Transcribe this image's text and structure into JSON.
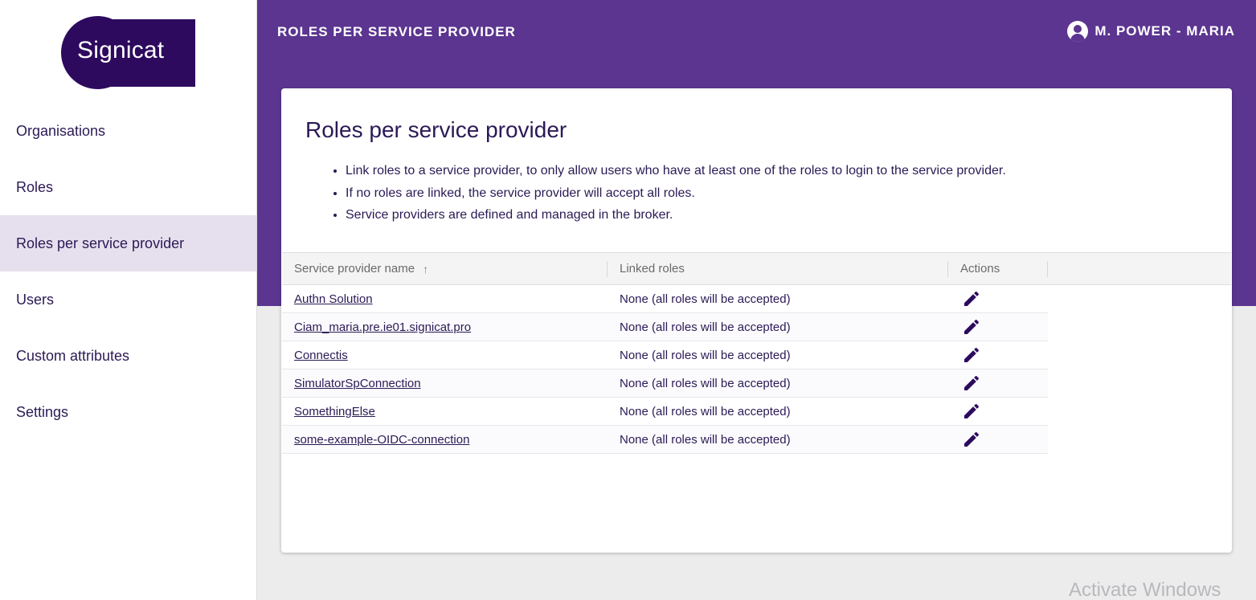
{
  "brand": {
    "name": "Signicat",
    "color": "#2d0a5e"
  },
  "sidebar": {
    "items": [
      {
        "label": "Organisations",
        "active": false
      },
      {
        "label": "Roles",
        "active": false
      },
      {
        "label": "Roles per service provider",
        "active": true
      },
      {
        "label": "Users",
        "active": false
      },
      {
        "label": "Custom attributes",
        "active": false
      },
      {
        "label": "Settings",
        "active": false
      }
    ]
  },
  "header": {
    "title": "ROLES PER SERVICE PROVIDER",
    "user": "M. POWER - MARIA",
    "user_icon": "account-circle-icon",
    "background": "#5b3590"
  },
  "main": {
    "title": "Roles per service provider",
    "bullets": [
      "Link roles to a service provider, to only allow users who have at least one of the roles to login to the service provider.",
      "If no roles are linked, the service provider will accept all roles.",
      "Service providers are defined and managed in the broker."
    ],
    "table": {
      "columns": [
        "Service provider name",
        "Linked roles",
        "Actions"
      ],
      "sort_icon": "arrow-up-icon",
      "sort_symbol": "↑",
      "rows": [
        {
          "name": "Authn Solution",
          "roles": "None (all roles will be accepted)"
        },
        {
          "name": "Ciam_maria.pre.ie01.signicat.pro",
          "roles": "None (all roles will be accepted)"
        },
        {
          "name": "Connectis",
          "roles": "None (all roles will be accepted)"
        },
        {
          "name": "SimulatorSpConnection",
          "roles": "None (all roles will be accepted)"
        },
        {
          "name": "SomethingElse",
          "roles": "None (all roles will be accepted)"
        },
        {
          "name": "some-example-OIDC-connection",
          "roles": "None (all roles will be accepted)"
        }
      ],
      "action_icon": "pencil-edit-icon"
    }
  },
  "watermark": "Activate Windows"
}
